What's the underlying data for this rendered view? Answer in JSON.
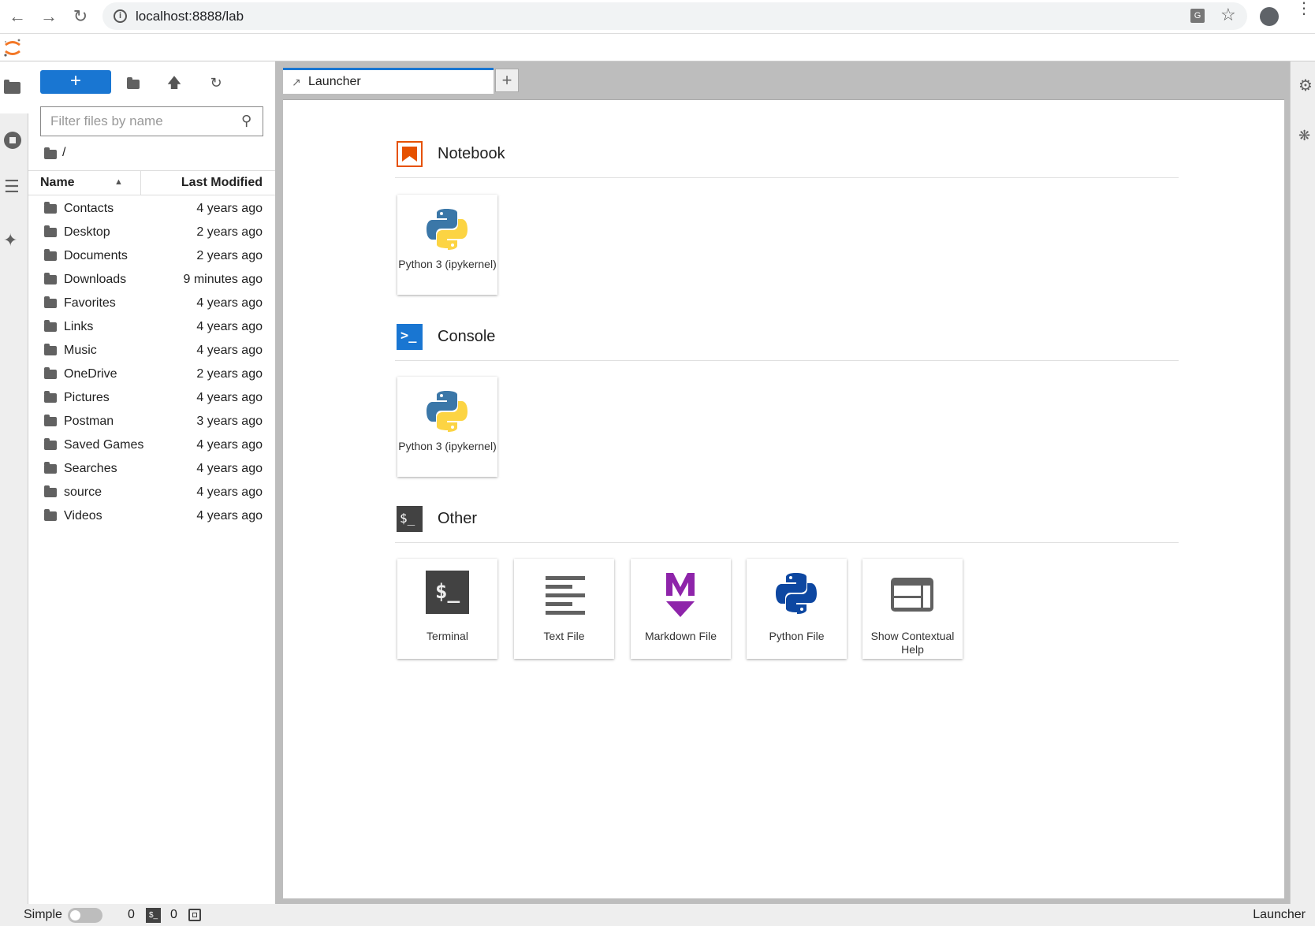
{
  "browser": {
    "url": "localhost:8888/lab"
  },
  "filebrowser": {
    "filter_placeholder": "Filter files by name",
    "breadcrumb": "/",
    "col_name": "Name",
    "col_modified": "Last Modified",
    "rows": [
      {
        "name": "Contacts",
        "modified": "4 years ago"
      },
      {
        "name": "Desktop",
        "modified": "2 years ago"
      },
      {
        "name": "Documents",
        "modified": "2 years ago"
      },
      {
        "name": "Downloads",
        "modified": "9 minutes ago"
      },
      {
        "name": "Favorites",
        "modified": "4 years ago"
      },
      {
        "name": "Links",
        "modified": "4 years ago"
      },
      {
        "name": "Music",
        "modified": "4 years ago"
      },
      {
        "name": "OneDrive",
        "modified": "2 years ago"
      },
      {
        "name": "Pictures",
        "modified": "4 years ago"
      },
      {
        "name": "Postman",
        "modified": "3 years ago"
      },
      {
        "name": "Saved Games",
        "modified": "4 years ago"
      },
      {
        "name": "Searches",
        "modified": "4 years ago"
      },
      {
        "name": "source",
        "modified": "4 years ago"
      },
      {
        "name": "Videos",
        "modified": "4 years ago"
      }
    ]
  },
  "tabs": {
    "launcher": "Launcher",
    "add": "+"
  },
  "launcher": {
    "notebook": {
      "title": "Notebook",
      "cards": [
        "Python 3 (ipykernel)"
      ]
    },
    "console": {
      "title": "Console",
      "cards": [
        "Python 3 (ipykernel)"
      ]
    },
    "other": {
      "title": "Other",
      "cards": [
        "Terminal",
        "Text File",
        "Markdown File",
        "Python File",
        "Show Contextual Help"
      ]
    }
  },
  "status": {
    "simple": "Simple",
    "kernels": "0",
    "terminals": "0",
    "right": "Launcher"
  },
  "colors": {
    "accent": "#1976d2",
    "notebook": "#e65100",
    "markdown": "#7b1fa2"
  }
}
